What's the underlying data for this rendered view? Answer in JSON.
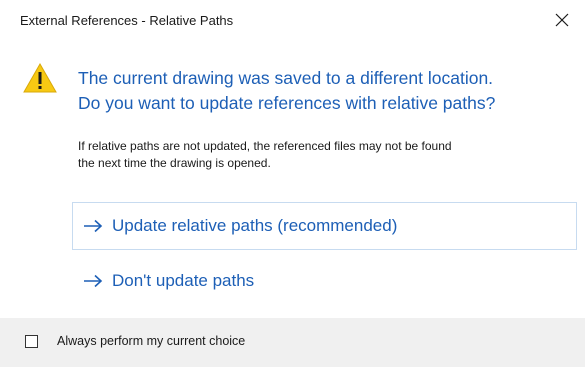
{
  "window": {
    "title": "External References - Relative Paths",
    "close_icon": "close-icon"
  },
  "icon": {
    "name": "warning-icon",
    "color": "#f7c913"
  },
  "main_instruction": {
    "line1": "The current drawing was saved to a different location.",
    "line2": "Do you want to update references with relative paths?"
  },
  "content": {
    "line1": "If relative paths are not updated, the referenced files may not be found",
    "line2": "the next time the drawing is opened."
  },
  "commands": [
    {
      "label": "Update relative paths (recommended)",
      "icon": "arrow-right-icon",
      "focused": true
    },
    {
      "label": "Don't update paths",
      "icon": "arrow-right-icon",
      "focused": false
    }
  ],
  "footer": {
    "checkbox_label": "Always perform my current choice",
    "checked": false
  },
  "colors": {
    "accent": "#1d5fb6",
    "footer_bg": "#f0f0f0",
    "focus_border": "#c7dbf0"
  }
}
